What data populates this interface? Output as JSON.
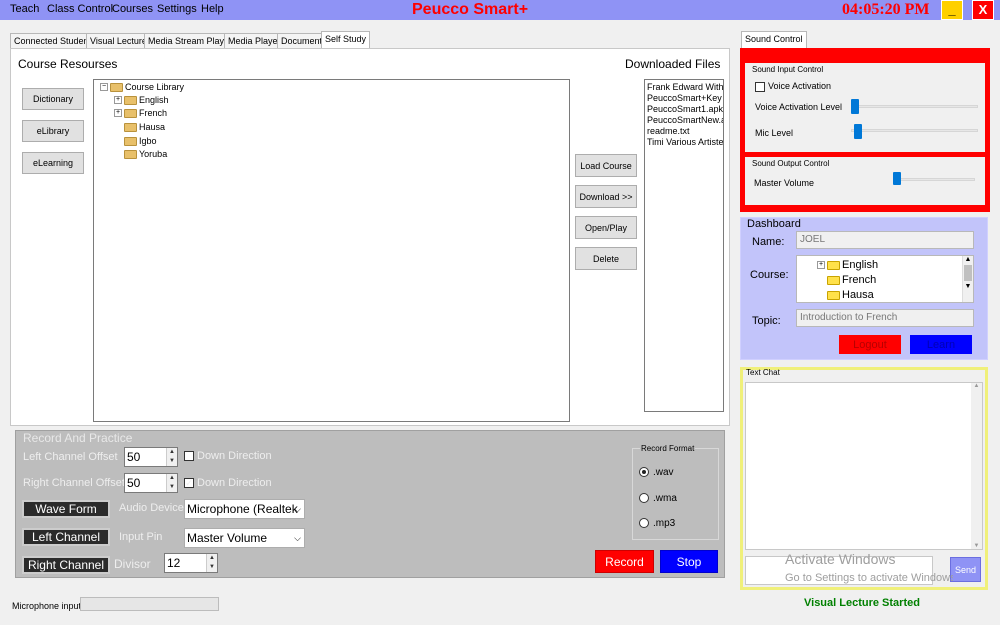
{
  "window": {
    "menu": [
      "Teach",
      "Class Control",
      "Courses",
      "Settings",
      "Help"
    ],
    "app_title": "Peucco Smart+",
    "clock": "04:05:20 PM",
    "minimize_label": "_",
    "close_label": "X"
  },
  "tabs": [
    "Connected Student",
    "Visual Lecture",
    "Media Stream Player",
    "Media Player",
    "Document",
    "Self Study"
  ],
  "self_study": {
    "course_resources_title": "Course Resourses",
    "downloaded_files_title": "Downloaded Files",
    "side_buttons": [
      "Dictionary",
      "eLibrary",
      "eLearning"
    ],
    "tree_root": "Course Library",
    "tree_items": [
      "English",
      "French",
      "Hausa",
      "Igbo",
      "Yoruba"
    ],
    "action_buttons": [
      "Load Course",
      "Download >>",
      "Open/Play",
      "Delete"
    ],
    "downloaded_files": [
      "Frank Edward With D",
      "PeuccoSmart+Key",
      "PeuccoSmart1.apk",
      "PeuccoSmartNew.apk",
      "readme.txt",
      "Timi Various Artiste - F"
    ]
  },
  "record": {
    "title": "Record And Practice",
    "left_offset_label": "Left Channel Offset",
    "left_offset_value": "50",
    "right_offset_label": "Right Channel Offset",
    "right_offset_value": "50",
    "down_direction_label": "Down Direction",
    "wave_form_label": "Wave Form",
    "left_channel_label": "Left Channel",
    "right_channel_label": "Right Channel",
    "audio_device_label": "Audio Device",
    "audio_device_value": "Microphone (Realtek",
    "input_pin_label": "Input Pin",
    "input_pin_value": "Master Volume",
    "divisor_label": "Divisor",
    "divisor_value": "12",
    "format_title": "Record Format",
    "formats": [
      ".wav",
      ".wma",
      ".mp3"
    ],
    "record_label": "Record",
    "stop_label": "Stop"
  },
  "status": {
    "mic_input_label": "Microphone input",
    "visual_lecture_status": "Visual Lecture Started"
  },
  "sound": {
    "tab_label": "Sound Control",
    "input_title": "Sound Input Control",
    "voice_activation_label": "Voice Activation",
    "voice_activation_level_label": "Voice Activation Level",
    "mic_level_label": "Mic Level",
    "output_title": "Sound Output Control",
    "master_volume_label": "Master Volume"
  },
  "dashboard": {
    "title": "Dashboard",
    "name_label": "Name:",
    "name_value": "JOEL",
    "course_label": "Course:",
    "courses": [
      "English",
      "French",
      "Hausa"
    ],
    "topic_label": "Topic:",
    "topic_value": "Introduction to French",
    "logout_label": "Logout",
    "learn_label": "Learn"
  },
  "chat": {
    "title": "Text Chat",
    "send_label": "Send",
    "watermark_line1": "Activate Windows",
    "watermark_line2": "Go to Settings to activate Windows."
  },
  "colors": {
    "title_bar": "#8f93f5",
    "title_red": "#ff0000",
    "dashboard_bg": "#c2c4fa",
    "chat_border": "#f0f07a",
    "record_bg": "#ff0000",
    "stop_bg": "#0000ff"
  }
}
